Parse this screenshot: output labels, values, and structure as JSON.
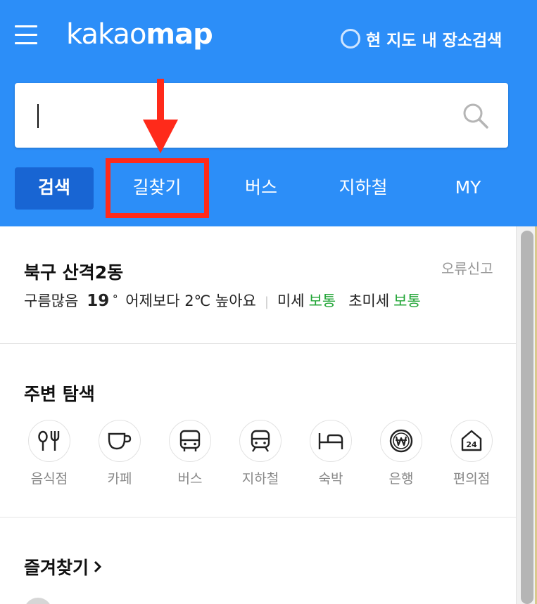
{
  "header": {
    "logo_light": "kakao",
    "logo_bold": "map",
    "map_search_toggle_label": "현 지도 내 장소검색",
    "background_color": "#2c8ef8"
  },
  "search": {
    "value": "",
    "placeholder": ""
  },
  "tabs": [
    {
      "label": "검색",
      "active": true
    },
    {
      "label": "길찾기",
      "active": false
    },
    {
      "label": "버스",
      "active": false
    },
    {
      "label": "지하철",
      "active": false
    },
    {
      "label": "MY",
      "active": false
    }
  ],
  "annotation": {
    "color": "#ff2a1a",
    "target": "길찾기"
  },
  "weather": {
    "location": "북구 산격2동",
    "report_label": "오류신고",
    "condition": "구름많음",
    "temperature": "19",
    "degree_symbol": "˚",
    "comparison": "어제보다 2℃ 높아요",
    "divider": "|",
    "fine_dust_label": "미세",
    "fine_dust_value": "보통",
    "ultra_fine_dust_label": "초미세",
    "ultra_fine_dust_value": "보통",
    "good_color": "#21a536"
  },
  "nearby": {
    "title": "주변 탐색",
    "categories": [
      {
        "label": "음식점",
        "icon": "fork-knife-icon"
      },
      {
        "label": "카페",
        "icon": "coffee-cup-icon"
      },
      {
        "label": "버스",
        "icon": "bus-icon"
      },
      {
        "label": "지하철",
        "icon": "train-icon"
      },
      {
        "label": "숙박",
        "icon": "bed-icon"
      },
      {
        "label": "은행",
        "icon": "won-coin-icon"
      },
      {
        "label": "편의점",
        "icon": "24h-store-icon"
      }
    ]
  },
  "favorites": {
    "title": "즐겨찾기"
  }
}
